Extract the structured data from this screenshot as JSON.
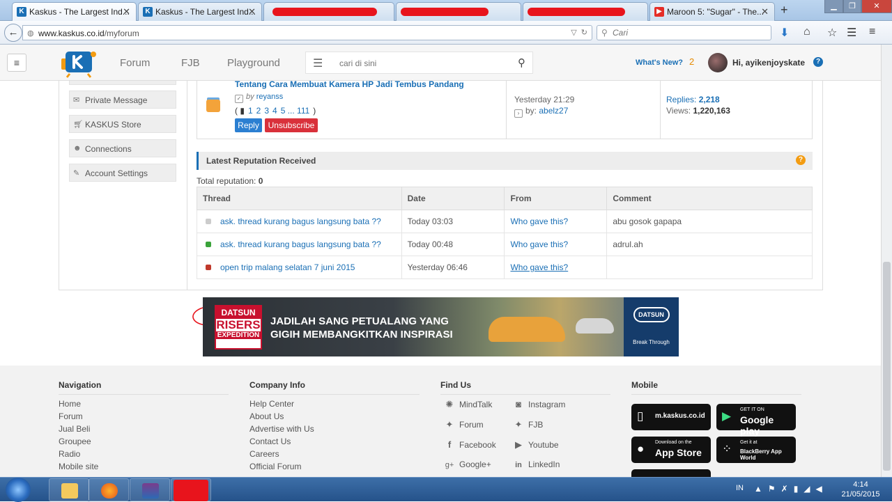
{
  "browser": {
    "tabs": [
      {
        "title": "Kaskus - The Largest Ind...",
        "active": true
      },
      {
        "title": "Kaskus - The Largest Ind...",
        "active": false
      },
      {
        "title": "",
        "redacted": true
      },
      {
        "title": "",
        "redacted": true
      },
      {
        "title": "",
        "redacted": true
      },
      {
        "title": "Maroon 5: \"Sugar\" - The...",
        "active": false
      }
    ],
    "url_host": "www.kaskus.co.id",
    "url_path": "/myforum",
    "search_placeholder": "Cari"
  },
  "header": {
    "nav": [
      "Forum",
      "FJB",
      "Playground"
    ],
    "search_placeholder": "cari di sini",
    "whats_new": "What's New?",
    "notif_count": "2",
    "greeting": "Hi, ayikenjoyskate"
  },
  "sidebar": {
    "items": [
      {
        "label": "Private Message",
        "icon": "envelope-icon"
      },
      {
        "label": "KASKUS Store",
        "icon": "cart-icon"
      },
      {
        "label": "Connections",
        "icon": "people-icon"
      },
      {
        "label": "Account Settings",
        "icon": "wrench-icon"
      }
    ]
  },
  "subscribed_thread": {
    "title": "Tentang Cara Membuat Kamera HP Jadi Tembus Pandang",
    "by_prefix": "by",
    "author": "reyanss",
    "pages": [
      "1",
      "2",
      "3",
      "4",
      "5 ... 111"
    ],
    "reply_label": "Reply",
    "unsubscribe_label": "Unsubscribe",
    "last_post_date": "Yesterday 21:29",
    "last_post_by_prefix": "by:",
    "last_post_by": "abelz27",
    "replies_label": "Replies:",
    "replies_value": "2,218",
    "views_label": "Views:",
    "views_value": "1,220,163"
  },
  "reputation": {
    "title": "Latest Reputation Received",
    "total_label": "Total reputation:",
    "total_value": "0",
    "columns": [
      "Thread",
      "Date",
      "From",
      "Comment"
    ],
    "rows": [
      {
        "status_color": "#cccccc",
        "thread": "ask. thread kurang bagus langsung bata ??",
        "date": "Today 03:03",
        "from": "Who gave this?",
        "comment": "abu gosok gapapa"
      },
      {
        "status_color": "#3aa33a",
        "thread": "ask. thread kurang bagus langsung bata ??",
        "date": "Today 00:48",
        "from": "Who gave this?",
        "comment": "adrul.ah"
      },
      {
        "status_color": "#c0392b",
        "thread": "open trip malang selatan 7 juni 2015",
        "date": "Yesterday 06:46",
        "from": "Who gave this?",
        "comment": ""
      }
    ]
  },
  "banner": {
    "logo_top": "DATSUN",
    "logo_mid": "RISERS",
    "logo_bottom": "EXPEDITION",
    "line1": "JADILAH SANG PETUALANG YANG",
    "line2": "GIGIH MEMBANGKITKAN INSPIRASI",
    "brand": "DATSUN",
    "tagline": "Break Through"
  },
  "footer": {
    "navigation": {
      "title": "Navigation",
      "links": [
        "Home",
        "Forum",
        "Jual Beli",
        "Groupee",
        "Radio",
        "Mobile site"
      ]
    },
    "company": {
      "title": "Company Info",
      "links": [
        "Help Center",
        "About Us",
        "Advertise with Us",
        "Contact Us",
        "Careers",
        "Official Forum"
      ]
    },
    "find_us": {
      "title": "Find Us",
      "links": [
        "MindTalk",
        "Instagram",
        "Forum",
        "FJB",
        "Facebook",
        "Youtube",
        "Google+",
        "LinkedIn"
      ]
    },
    "mobile": {
      "title": "Mobile",
      "stores": [
        {
          "main": "m.kaskus.co.id"
        },
        {
          "small": "GET IT ON",
          "main": "Google play"
        },
        {
          "small": "Download on the",
          "main": "App Store"
        },
        {
          "small": "Get it at",
          "main": "BlackBerry App World"
        }
      ]
    }
  },
  "taskbar": {
    "language": "IN",
    "time": "4:14",
    "date": "21/05/2015"
  },
  "colors": {
    "link": "#1a6fb5",
    "unsubscribe": "#d9313b",
    "reply": "#2b7fd1",
    "annotation": "#e8141c"
  }
}
